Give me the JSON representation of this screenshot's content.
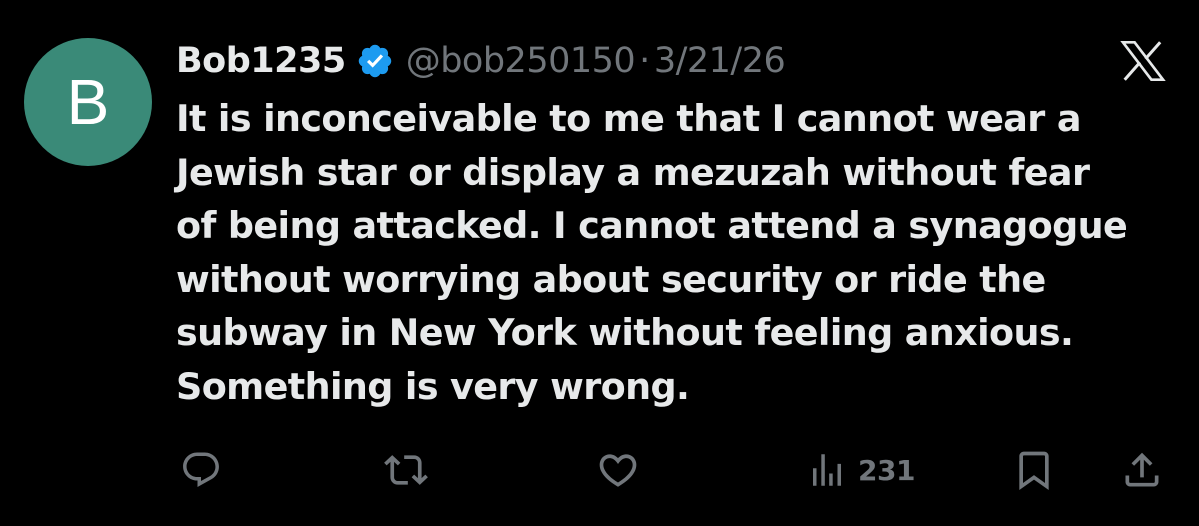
{
  "author": {
    "avatar_letter": "B",
    "avatar_color": "#3a8a78",
    "display_name": "Bob1235",
    "verified_badge_color": "#1d9bf0",
    "handle": "@bob250150",
    "separator": "·",
    "date": "3/21/26"
  },
  "platform": {
    "logo_icon": "x-logo-icon"
  },
  "tweet": {
    "text": "It is inconceivable to me that I cannot wear a\nJewish star or display a mezuzah without fear\nof being attacked. I cannot attend a synagogue\nwithout worrying about security or ride the\nsubway in New York without feeling anxious.\nSomething is very wrong."
  },
  "actions": {
    "reply_icon": "reply-icon",
    "retweet_icon": "retweet-icon",
    "like_icon": "heart-icon",
    "views_icon": "views-icon",
    "views_count": "231",
    "bookmark_icon": "bookmark-icon",
    "share_icon": "share-icon"
  },
  "colors": {
    "background": "#000000",
    "primary_text": "#e7e9ea",
    "secondary_text": "#71767b"
  }
}
